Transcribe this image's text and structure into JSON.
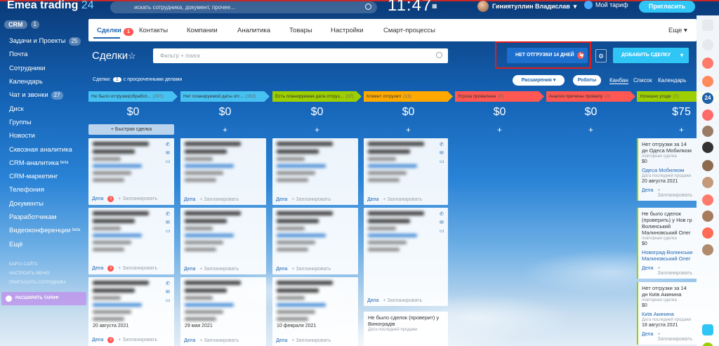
{
  "topbar": {
    "logo_name": "Emea trading",
    "logo_num": "24",
    "search_placeholder": "искать сотрудника, документ, прочее...",
    "clock": "11:47",
    "user_name": "Гиниятуллин Владислав",
    "tariff_label": "Мой тариф",
    "invite_label": "Пригласить"
  },
  "sidebar": {
    "crm_label": "CRM",
    "crm_count": "1",
    "items": [
      {
        "label": "Задачи и Проекты",
        "badge": "25"
      },
      {
        "label": "Почта",
        "badge": ""
      },
      {
        "label": "Сотрудники",
        "badge": ""
      },
      {
        "label": "Календарь",
        "badge": ""
      },
      {
        "label": "Чат и звонки",
        "badge": "27"
      },
      {
        "label": "Диск",
        "badge": ""
      },
      {
        "label": "Группы",
        "badge": ""
      },
      {
        "label": "Новости",
        "badge": ""
      },
      {
        "label": "Сквозная аналитика",
        "badge": ""
      },
      {
        "label": "CRM-аналитика",
        "sup": "beta",
        "badge": ""
      },
      {
        "label": "CRM-маркетинг",
        "badge": ""
      },
      {
        "label": "Телефония",
        "badge": ""
      },
      {
        "label": "Документы",
        "badge": ""
      },
      {
        "label": "Разработчикам",
        "badge": ""
      },
      {
        "label": "Видеоконференции",
        "sup": "beta",
        "badge": ""
      },
      {
        "label": "Ещё",
        "badge": ""
      }
    ],
    "small_links": [
      "карта сайта",
      "настроить меню",
      "пригласить сотрудника"
    ],
    "upgrade_label": "расширить тариф"
  },
  "tabs": [
    {
      "label": "Сделки",
      "badge": "1"
    },
    {
      "label": "Контакты"
    },
    {
      "label": "Компании"
    },
    {
      "label": "Аналитика"
    },
    {
      "label": "Товары"
    },
    {
      "label": "Настройки"
    },
    {
      "label": "Смарт-процессы"
    }
  ],
  "tabs_more": "Еще",
  "toolbar": {
    "title": "Сделки",
    "filter_placeholder": "Фильтр + поиск",
    "preset_label": "нет отгрузки 14 дней",
    "preset_count": "1",
    "add_label": "добавить сделку"
  },
  "subheader": {
    "deals_prefix": "Сделки:",
    "overdue_count": "1",
    "overdue_text": "с просроченными делами",
    "extensions": "Расширения",
    "robots": "Роботы",
    "views": [
      "Канбан",
      "Список",
      "Календарь"
    ]
  },
  "columns": [
    {
      "title": "Не было отгрузки(обработ...",
      "count": "(297)",
      "amount": "$0",
      "color": "#47c1f1"
    },
    {
      "title": "Нет планируемой даты отг...",
      "count": "(162)",
      "amount": "$0",
      "color": "#47c1f1"
    },
    {
      "title": "Есть планируемая дата отгруз...",
      "count": "(37)",
      "amount": "$0",
      "color": "#9dcf00"
    },
    {
      "title": "Клиент отгрузил",
      "count": "(13)",
      "amount": "$0",
      "color": "#ffa900"
    },
    {
      "title": "Угроза провалена",
      "count": "(0)",
      "amount": "$0",
      "color": "#ff5752"
    },
    {
      "title": "Анализ причины провалу",
      "count": "(0)",
      "amount": "$0",
      "color": "#ff5752"
    },
    {
      "title": "Успешно угоди",
      "count": "(7)",
      "amount": "$75",
      "color": "#9dcf00"
    }
  ],
  "quick_deal": "+ Быстрая сделка",
  "blurred_dates": [
    "20 августа 2021",
    "29 мая 2021",
    "10 февраля 2021"
  ],
  "card_foot": {
    "deals": "Дела",
    "plan": "+ Запланировать"
  },
  "success_cards": [
    {
      "title": "Нет отгрузки за 14 дн Одеса Мобилком",
      "label": "повторная сделка",
      "value": "$0",
      "company": "Одеса Мобилком",
      "date_label": "Дата последней продажи",
      "date": "20 августа 2021"
    },
    {
      "title": "Не было сделок (проверить) у Нов гр Волинський Малиновський Олег",
      "label": "повторная сделка",
      "value": "$0",
      "company": "Новоград-Волинськи Малиновський Олег",
      "date_label": "",
      "date": ""
    },
    {
      "title": "Нет отгрузки за 14 дн Київ Акинина",
      "label": "повторная сделка",
      "value": "$0",
      "company": "Київ Акинина",
      "date_label": "Дата последней продажи",
      "date": "18 августа 2021"
    }
  ],
  "visible_card": {
    "title": "Не было сделок (проверит) у Виноградів",
    "label": "Дата последней продажи"
  }
}
